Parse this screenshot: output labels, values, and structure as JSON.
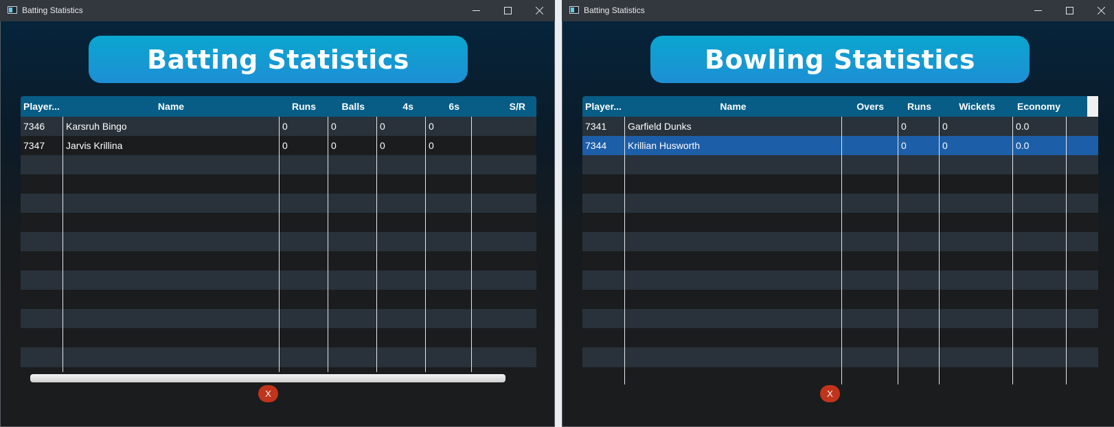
{
  "batting": {
    "window_title": "Batting Statistics",
    "banner": "Batting Statistics",
    "headers": [
      "Player...",
      "Name",
      "Runs",
      "Balls",
      "4s",
      "6s",
      "S/R"
    ],
    "rows": [
      [
        "7346",
        "Karsruh Bingo",
        "0",
        "0",
        "0",
        "0",
        ""
      ],
      [
        "7347",
        "Jarvis Krillina",
        "0",
        "0",
        "0",
        "0",
        ""
      ]
    ],
    "close_label": "X"
  },
  "bowling": {
    "window_title": "Batting Statistics",
    "banner": "Bowling Statistics",
    "headers": [
      "Player...",
      "Name",
      "Overs",
      "Runs",
      "Wickets",
      "Economy"
    ],
    "rows": [
      [
        "7341",
        "Garfield Dunks",
        "",
        "0",
        "0",
        "0.0"
      ],
      [
        "7344",
        "Krillian Husworth",
        "",
        "0",
        "0",
        "0.0"
      ]
    ],
    "selected_row": 1,
    "close_label": "X"
  }
}
